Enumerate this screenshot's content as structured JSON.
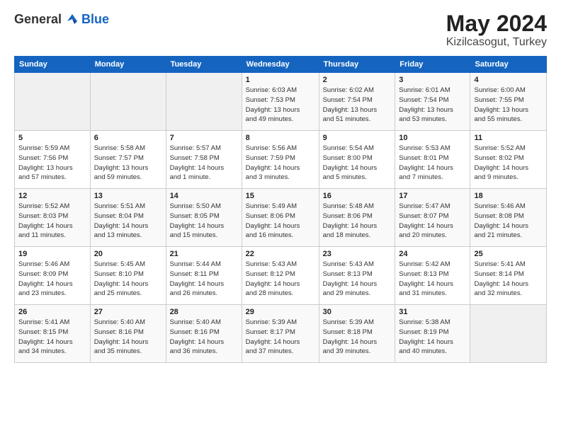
{
  "logo": {
    "general": "General",
    "blue": "Blue"
  },
  "header": {
    "title": "May 2024",
    "subtitle": "Kizilcasogut, Turkey"
  },
  "days_of_week": [
    "Sunday",
    "Monday",
    "Tuesday",
    "Wednesday",
    "Thursday",
    "Friday",
    "Saturday"
  ],
  "weeks": [
    [
      {
        "day": "",
        "info": ""
      },
      {
        "day": "",
        "info": ""
      },
      {
        "day": "",
        "info": ""
      },
      {
        "day": "1",
        "info": "Sunrise: 6:03 AM\nSunset: 7:53 PM\nDaylight: 13 hours\nand 49 minutes."
      },
      {
        "day": "2",
        "info": "Sunrise: 6:02 AM\nSunset: 7:54 PM\nDaylight: 13 hours\nand 51 minutes."
      },
      {
        "day": "3",
        "info": "Sunrise: 6:01 AM\nSunset: 7:54 PM\nDaylight: 13 hours\nand 53 minutes."
      },
      {
        "day": "4",
        "info": "Sunrise: 6:00 AM\nSunset: 7:55 PM\nDaylight: 13 hours\nand 55 minutes."
      }
    ],
    [
      {
        "day": "5",
        "info": "Sunrise: 5:59 AM\nSunset: 7:56 PM\nDaylight: 13 hours\nand 57 minutes."
      },
      {
        "day": "6",
        "info": "Sunrise: 5:58 AM\nSunset: 7:57 PM\nDaylight: 13 hours\nand 59 minutes."
      },
      {
        "day": "7",
        "info": "Sunrise: 5:57 AM\nSunset: 7:58 PM\nDaylight: 14 hours\nand 1 minute."
      },
      {
        "day": "8",
        "info": "Sunrise: 5:56 AM\nSunset: 7:59 PM\nDaylight: 14 hours\nand 3 minutes."
      },
      {
        "day": "9",
        "info": "Sunrise: 5:54 AM\nSunset: 8:00 PM\nDaylight: 14 hours\nand 5 minutes."
      },
      {
        "day": "10",
        "info": "Sunrise: 5:53 AM\nSunset: 8:01 PM\nDaylight: 14 hours\nand 7 minutes."
      },
      {
        "day": "11",
        "info": "Sunrise: 5:52 AM\nSunset: 8:02 PM\nDaylight: 14 hours\nand 9 minutes."
      }
    ],
    [
      {
        "day": "12",
        "info": "Sunrise: 5:52 AM\nSunset: 8:03 PM\nDaylight: 14 hours\nand 11 minutes."
      },
      {
        "day": "13",
        "info": "Sunrise: 5:51 AM\nSunset: 8:04 PM\nDaylight: 14 hours\nand 13 minutes."
      },
      {
        "day": "14",
        "info": "Sunrise: 5:50 AM\nSunset: 8:05 PM\nDaylight: 14 hours\nand 15 minutes."
      },
      {
        "day": "15",
        "info": "Sunrise: 5:49 AM\nSunset: 8:06 PM\nDaylight: 14 hours\nand 16 minutes."
      },
      {
        "day": "16",
        "info": "Sunrise: 5:48 AM\nSunset: 8:06 PM\nDaylight: 14 hours\nand 18 minutes."
      },
      {
        "day": "17",
        "info": "Sunrise: 5:47 AM\nSunset: 8:07 PM\nDaylight: 14 hours\nand 20 minutes."
      },
      {
        "day": "18",
        "info": "Sunrise: 5:46 AM\nSunset: 8:08 PM\nDaylight: 14 hours\nand 21 minutes."
      }
    ],
    [
      {
        "day": "19",
        "info": "Sunrise: 5:46 AM\nSunset: 8:09 PM\nDaylight: 14 hours\nand 23 minutes."
      },
      {
        "day": "20",
        "info": "Sunrise: 5:45 AM\nSunset: 8:10 PM\nDaylight: 14 hours\nand 25 minutes."
      },
      {
        "day": "21",
        "info": "Sunrise: 5:44 AM\nSunset: 8:11 PM\nDaylight: 14 hours\nand 26 minutes."
      },
      {
        "day": "22",
        "info": "Sunrise: 5:43 AM\nSunset: 8:12 PM\nDaylight: 14 hours\nand 28 minutes."
      },
      {
        "day": "23",
        "info": "Sunrise: 5:43 AM\nSunset: 8:13 PM\nDaylight: 14 hours\nand 29 minutes."
      },
      {
        "day": "24",
        "info": "Sunrise: 5:42 AM\nSunset: 8:13 PM\nDaylight: 14 hours\nand 31 minutes."
      },
      {
        "day": "25",
        "info": "Sunrise: 5:41 AM\nSunset: 8:14 PM\nDaylight: 14 hours\nand 32 minutes."
      }
    ],
    [
      {
        "day": "26",
        "info": "Sunrise: 5:41 AM\nSunset: 8:15 PM\nDaylight: 14 hours\nand 34 minutes."
      },
      {
        "day": "27",
        "info": "Sunrise: 5:40 AM\nSunset: 8:16 PM\nDaylight: 14 hours\nand 35 minutes."
      },
      {
        "day": "28",
        "info": "Sunrise: 5:40 AM\nSunset: 8:16 PM\nDaylight: 14 hours\nand 36 minutes."
      },
      {
        "day": "29",
        "info": "Sunrise: 5:39 AM\nSunset: 8:17 PM\nDaylight: 14 hours\nand 37 minutes."
      },
      {
        "day": "30",
        "info": "Sunrise: 5:39 AM\nSunset: 8:18 PM\nDaylight: 14 hours\nand 39 minutes."
      },
      {
        "day": "31",
        "info": "Sunrise: 5:38 AM\nSunset: 8:19 PM\nDaylight: 14 hours\nand 40 minutes."
      },
      {
        "day": "",
        "info": ""
      }
    ]
  ]
}
